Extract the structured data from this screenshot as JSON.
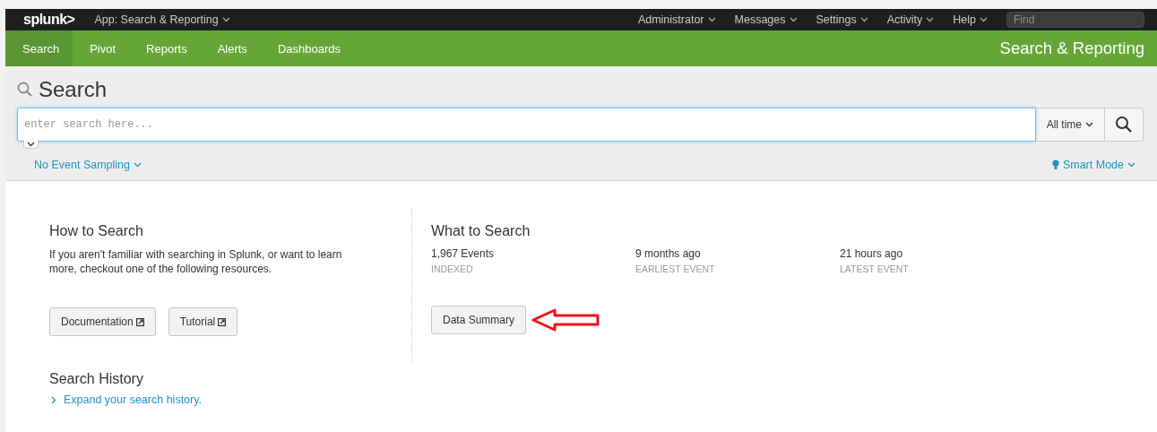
{
  "top_bar": {
    "logo": "splunk>",
    "app_menu": "App: Search & Reporting",
    "menus": [
      "Administrator",
      "Messages",
      "Settings",
      "Activity",
      "Help"
    ],
    "find": {
      "placeholder": "Find"
    }
  },
  "nav": {
    "tabs": [
      {
        "label": "Search",
        "selected": true
      },
      {
        "label": "Pivot",
        "selected": false
      },
      {
        "label": "Reports",
        "selected": false
      },
      {
        "label": "Alerts",
        "selected": false
      },
      {
        "label": "Dashboards",
        "selected": false
      }
    ],
    "app_title": "Search & Reporting"
  },
  "search": {
    "title": "Search",
    "field": {
      "placeholder": "enter search here...",
      "expanded": false
    },
    "time_range": "All time",
    "sampling": "No Event Sampling",
    "mode": "Smart Mode"
  },
  "how_to_search": {
    "title": "How to Search",
    "text": "If you aren't familiar with searching in Splunk, or want to learn more, checkout one of the following resources.",
    "buttons": [
      {
        "label": "Documentation",
        "external": true
      },
      {
        "label": "Tutorial",
        "external": true
      }
    ]
  },
  "search_history": {
    "title": "Search History",
    "link": "Expand your search history."
  },
  "what_to_search": {
    "title": "What to Search",
    "stats": [
      {
        "value": "1,967 Events",
        "label": "INDEXED"
      },
      {
        "value": "9 months ago",
        "label": "EARLIEST EVENT"
      },
      {
        "value": "21 hours ago",
        "label": "LATEST EVENT"
      }
    ],
    "button": "Data Summary"
  }
}
